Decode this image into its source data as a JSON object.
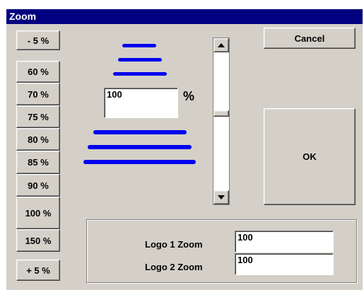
{
  "window": {
    "title": "Zoom"
  },
  "zoom_buttons": [
    {
      "label": "- 5 %"
    },
    {
      "label": "60 %"
    },
    {
      "label": "70 %"
    },
    {
      "label": "75 %"
    },
    {
      "label": "80 %"
    },
    {
      "label": "85 %"
    },
    {
      "label": "90 %"
    },
    {
      "label": "100 %"
    },
    {
      "label": "150 %"
    },
    {
      "label": "+ 5 %"
    }
  ],
  "zoom_field": {
    "value": "100",
    "unit": "%"
  },
  "actions": {
    "cancel_label": "Cancel",
    "ok_label": "OK"
  },
  "logos": {
    "logo1_label": "Logo 1  Zoom",
    "logo1_value": "100",
    "logo2_label": "Logo 2  Zoom",
    "logo2_value": "100"
  },
  "scrollbar": {
    "up_icon": "up-arrow-icon",
    "down_icon": "down-arrow-icon"
  },
  "colors": {
    "titlebar": "#000080",
    "face": "#d4d0c8",
    "zoom_lines": "#0000ee"
  }
}
